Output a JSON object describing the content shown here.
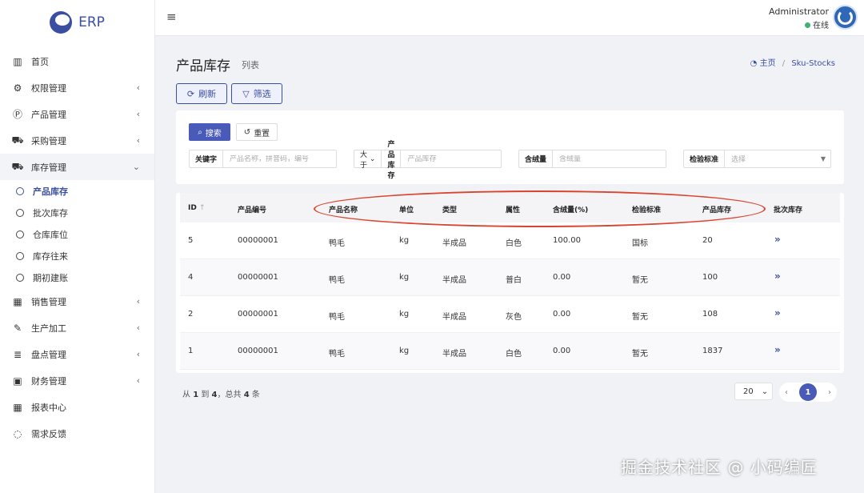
{
  "app": {
    "logo_text": "ERP"
  },
  "sidebar": {
    "items": [
      {
        "icon": "bar-chart-icon",
        "glyph": "▥",
        "label": "首页",
        "chevron": ""
      },
      {
        "icon": "gear-icon",
        "glyph": "⚙",
        "label": "权限管理",
        "chevron": "‹"
      },
      {
        "icon": "product-icon",
        "glyph": "Ⓟ",
        "label": "产品管理",
        "chevron": "‹"
      },
      {
        "icon": "cart-icon",
        "glyph": "⛟",
        "label": "采购管理",
        "chevron": "‹"
      },
      {
        "icon": "truck-icon",
        "glyph": "⛟",
        "label": "库存管理",
        "chevron": "⌄"
      }
    ],
    "sub_items": [
      "产品库存",
      "批次库存",
      "仓库库位",
      "库存往来",
      "期初建账"
    ],
    "items_after": [
      {
        "icon": "calendar-icon",
        "glyph": "▦",
        "label": "销售管理",
        "chevron": "‹"
      },
      {
        "icon": "wrench-icon",
        "glyph": "✎",
        "label": "生产加工",
        "chevron": "‹"
      },
      {
        "icon": "database-icon",
        "glyph": "≣",
        "label": "盘点管理",
        "chevron": "‹"
      },
      {
        "icon": "money-icon",
        "glyph": "▣",
        "label": "财务管理",
        "chevron": "‹"
      },
      {
        "icon": "calendar-grid-icon",
        "glyph": "▦",
        "label": "报表中心",
        "chevron": ""
      },
      {
        "icon": "comment-icon",
        "glyph": "◌",
        "label": "需求反馈",
        "chevron": ""
      }
    ]
  },
  "header": {
    "hamburger": "≡",
    "user_name": "Administrator",
    "user_status": "在线"
  },
  "page": {
    "title": "产品库存",
    "subtitle": "列表",
    "breadcrumb_home": "主页",
    "breadcrumb_sep": "/",
    "breadcrumb_current": "Sku-Stocks",
    "refresh_label": "刷新",
    "filter_label": "筛选"
  },
  "filters": {
    "search_label": "搜索",
    "reset_label": "重置",
    "keyword_label": "关键字",
    "keyword_placeholder": "产品名称，拼音码，编号",
    "compare_label": "大于",
    "stock_label": "产品库存",
    "stock_placeholder": "产品库存",
    "down_label": "含绒量",
    "down_placeholder": "含绒量",
    "standard_label": "检验标准",
    "standard_placeholder": "选择"
  },
  "table": {
    "columns": [
      "ID",
      "产品编号",
      "产品名称",
      "单位",
      "类型",
      "属性",
      "含绒量(%)",
      "检验标准",
      "产品库存",
      "批次库存"
    ],
    "sort_indicator": "↑",
    "rows": [
      {
        "id": "5",
        "code": "00000001",
        "name": "鸭毛",
        "unit": "kg",
        "type": "半成品",
        "attr": "白色",
        "down": "100.00",
        "standard": "国标",
        "stock": "20",
        "action": "»"
      },
      {
        "id": "4",
        "code": "00000001",
        "name": "鸭毛",
        "unit": "kg",
        "type": "半成品",
        "attr": "普白",
        "down": "0.00",
        "standard": "暂无",
        "stock": "100",
        "action": "»"
      },
      {
        "id": "2",
        "code": "00000001",
        "name": "鸭毛",
        "unit": "kg",
        "type": "半成品",
        "attr": "灰色",
        "down": "0.00",
        "standard": "暂无",
        "stock": "108",
        "action": "»"
      },
      {
        "id": "1",
        "code": "00000001",
        "name": "鸭毛",
        "unit": "kg",
        "type": "半成品",
        "attr": "白色",
        "down": "0.00",
        "standard": "暂无",
        "stock": "1837",
        "action": "»"
      }
    ]
  },
  "footer": {
    "summary_prefix": "从",
    "summary_from": "1",
    "summary_to_word": "到",
    "summary_to": "4",
    "summary_total_word": "，总共",
    "summary_total": "4",
    "summary_suffix": "条",
    "page_size": "20",
    "prev": "‹",
    "current_page": "1",
    "next": "›"
  },
  "watermark": "掘金技术社区 @ 小码编匠",
  "colors": {
    "accent": "#3a4fa0",
    "button": "#4a5ab8",
    "annotation": "#d9452f"
  }
}
